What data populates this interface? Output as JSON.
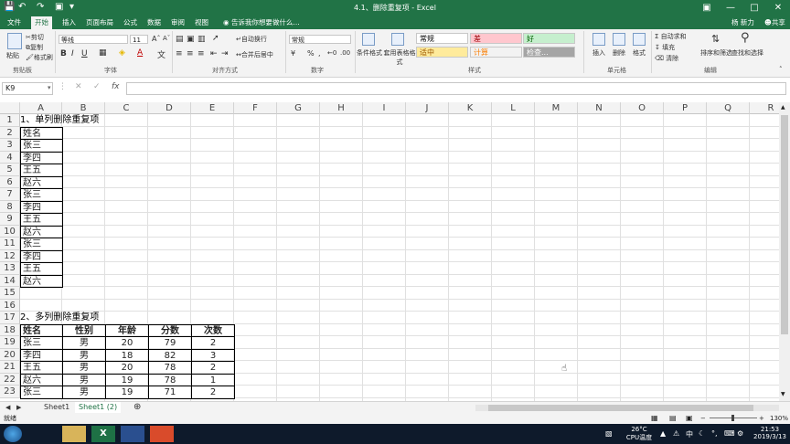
{
  "window": {
    "title": "4.1、删除重复项 - Excel",
    "user": "杨 新力",
    "share": "共享"
  },
  "menu": {
    "tabs": [
      "文件",
      "开始",
      "插入",
      "页面布局",
      "公式",
      "数据",
      "审阅",
      "视图"
    ],
    "active": "开始",
    "tell_me": "告诉我你想要做什么..."
  },
  "ribbon": {
    "clipboard": {
      "paste": "粘贴",
      "cut": "剪切",
      "copy": "复制",
      "format_painter": "格式刷",
      "label": "剪贴板"
    },
    "font": {
      "name": "等线",
      "size": "11",
      "label": "字体"
    },
    "alignment": {
      "wrap": "自动换行",
      "merge": "合并后居中",
      "label": "对齐方式"
    },
    "number": {
      "format": "常规",
      "label": "数字"
    },
    "styles": {
      "conditional": "条件格式",
      "table_format": "套用表格格式",
      "cells": [
        {
          "text": "常规",
          "bg": "#ffffff",
          "fg": "#000000"
        },
        {
          "text": "差",
          "bg": "#ffc7ce",
          "fg": "#9c0006"
        },
        {
          "text": "好",
          "bg": "#c6efce",
          "fg": "#006100"
        },
        {
          "text": "适中",
          "bg": "#ffeb9c",
          "fg": "#9c5700"
        },
        {
          "text": "计算",
          "bg": "#f2f2f2",
          "fg": "#fa7d00"
        },
        {
          "text": "检查...",
          "bg": "#a5a5a5",
          "fg": "#ffffff"
        }
      ],
      "label": "样式"
    },
    "cells_group": {
      "insert": "插入",
      "delete": "删除",
      "format": "格式",
      "label": "单元格"
    },
    "editing": {
      "autosum": "自动求和",
      "fill": "填充",
      "clear": "清除",
      "sort": "排序和筛选",
      "find": "查找和选择",
      "label": "编辑"
    }
  },
  "formula_bar": {
    "name_box": "K9",
    "fx": "fx",
    "content": ""
  },
  "grid": {
    "columns": [
      "A",
      "B",
      "C",
      "D",
      "E",
      "F",
      "G",
      "H",
      "I",
      "J",
      "K",
      "L",
      "M",
      "N",
      "O",
      "P",
      "Q",
      "R"
    ],
    "rows": [
      "1",
      "2",
      "3",
      "4",
      "5",
      "6",
      "7",
      "8",
      "9",
      "10",
      "11",
      "12",
      "13",
      "14",
      "15",
      "16",
      "17",
      "18",
      "19",
      "20",
      "21",
      "22",
      "23"
    ],
    "section1_title": "1、单列删除重复项",
    "section1_header": "姓名",
    "section1_names": [
      "张三",
      "李四",
      "王五",
      "赵六",
      "张三",
      "李四",
      "王五",
      "赵六",
      "张三",
      "李四",
      "王五",
      "赵六"
    ],
    "section2_title": "2、多列删除重复项",
    "section2_headers": [
      "姓名",
      "性别",
      "年龄",
      "分数",
      "次数"
    ],
    "section2_rows": [
      [
        "张三",
        "男",
        "20",
        "79",
        "2"
      ],
      [
        "李四",
        "男",
        "18",
        "82",
        "3"
      ],
      [
        "王五",
        "男",
        "20",
        "78",
        "2"
      ],
      [
        "赵六",
        "男",
        "19",
        "78",
        "1"
      ],
      [
        "张三",
        "男",
        "19",
        "71",
        "2"
      ]
    ]
  },
  "sheets": {
    "tabs": [
      "Sheet1",
      "Sheet1 (2)"
    ],
    "active": "Sheet1 (2)"
  },
  "status": {
    "ready": "就绪",
    "zoom": "130%"
  },
  "taskbar": {
    "temp": "26°C",
    "temp_label": "CPU温度",
    "time": "21:53",
    "date": "2019/3/13"
  }
}
